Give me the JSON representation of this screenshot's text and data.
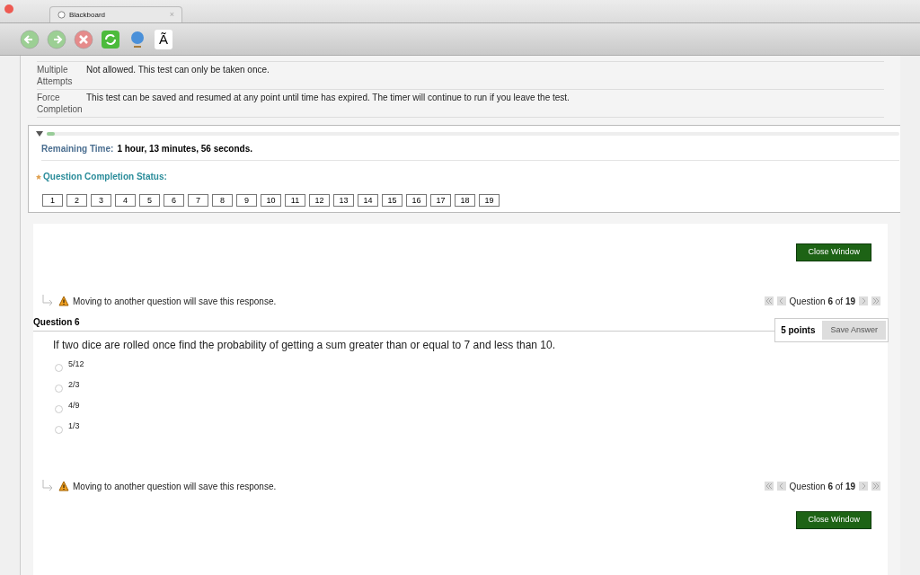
{
  "tab": {
    "title": "Blackboard",
    "close": "×"
  },
  "toolbar": {
    "font_button": "Ã"
  },
  "settings": [
    {
      "label": "Multiple Attempts",
      "value": "Not allowed. This test can only be taken once."
    },
    {
      "label": "Force Completion",
      "value": "This test can be saved and resumed at any point until time has expired. The timer will continue to run if you leave the test."
    }
  ],
  "timer": {
    "label": "Remaining Time:",
    "value": "1 hour, 13 minutes, 56 seconds.",
    "expanded": true,
    "level": 0.01
  },
  "completion": {
    "title": "Question Completion Status:",
    "questions": [
      "1",
      "2",
      "3",
      "4",
      "5",
      "6",
      "7",
      "8",
      "9",
      "10",
      "11",
      "12",
      "13",
      "14",
      "15",
      "16",
      "17",
      "18",
      "19"
    ]
  },
  "close_button": "Close Window",
  "notice": "Moving to another question will save this response.",
  "pager": "Question **6** of **19**",
  "question": {
    "title": "Question 6",
    "points": "5 points",
    "save": "Save Answer",
    "text": "If two dice are rolled once find the probability of getting a sum greater than or equal to 7 and less than 10.",
    "options": [
      {
        "label": "5/12",
        "selected": false
      },
      {
        "label": "2/3",
        "selected": false
      },
      {
        "label": "4/9",
        "selected": false
      },
      {
        "label": "1/3",
        "selected": false
      }
    ]
  },
  "notice_bottom": "Moving to another question will save this response.",
  "pager_bottom": "Question **6** of **19**",
  "close_button_bottom": "Close Window"
}
